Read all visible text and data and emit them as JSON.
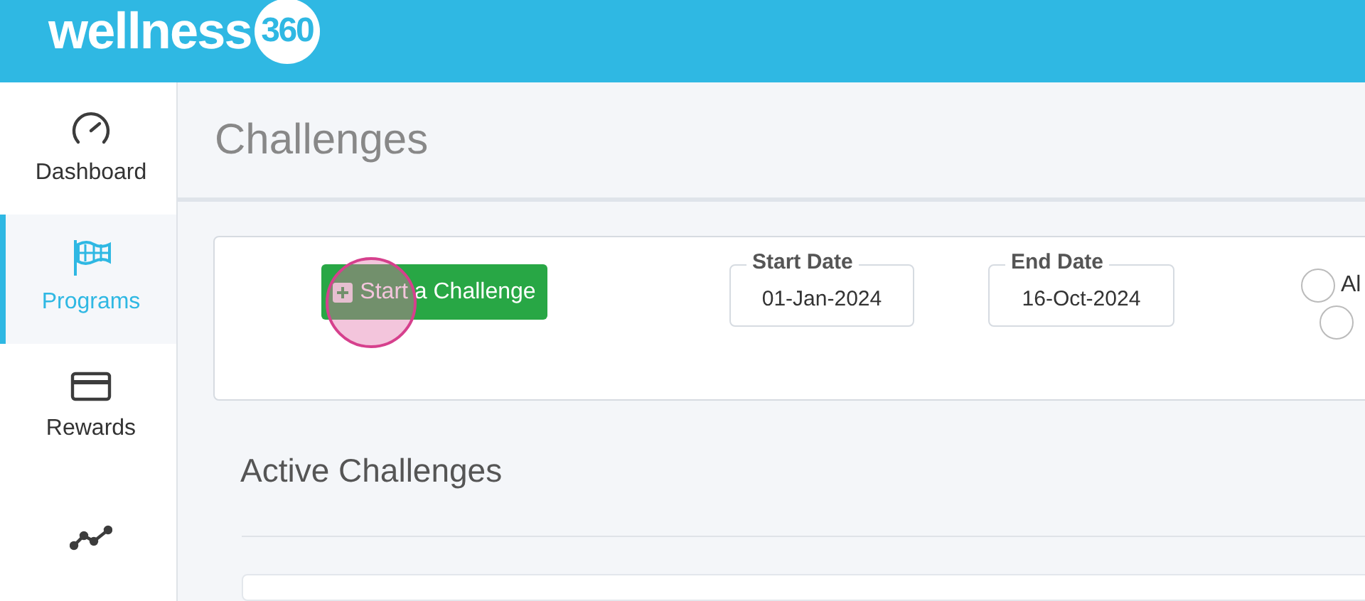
{
  "logo": {
    "word": "wellness",
    "number": "360"
  },
  "sidebar": {
    "items": [
      {
        "label": "Dashboard",
        "kind": "gauge",
        "selected": false
      },
      {
        "label": "Programs",
        "kind": "flag",
        "selected": true
      },
      {
        "label": "Rewards",
        "kind": "card",
        "selected": false
      },
      {
        "kind": "chart",
        "selected": false
      }
    ]
  },
  "page_title": "Challenges",
  "filters": {
    "start_button": "Start a Challenge",
    "start_date": {
      "label": "Start Date",
      "value": "01-Jan-2024"
    },
    "end_date": {
      "label": "End Date",
      "value": "16-Oct-2024"
    },
    "radios": [
      {
        "label": "Al",
        "selected": false
      },
      {
        "selected": false
      }
    ]
  },
  "click_highlight": true,
  "section_title": "Active Challenges"
}
